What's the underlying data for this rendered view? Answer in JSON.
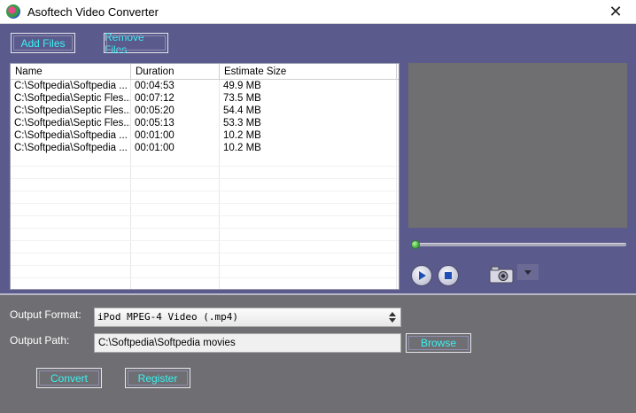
{
  "window": {
    "title": "Asoftech Video Converter",
    "close_glyph": "✕"
  },
  "toolbar": {
    "add_files_label": "Add Files",
    "remove_files_label": "Remove Files"
  },
  "file_list": {
    "columns": [
      "Name",
      "Duration",
      "Estimate Size"
    ],
    "rows": [
      {
        "name": "C:\\Softpedia\\Softpedia ...",
        "duration": "00:04:53",
        "size": "49.9 MB"
      },
      {
        "name": "C:\\Softpedia\\Septic Fles...",
        "duration": "00:07:12",
        "size": "73.5 MB"
      },
      {
        "name": "C:\\Softpedia\\Septic Fles...",
        "duration": "00:05:20",
        "size": "54.4 MB"
      },
      {
        "name": "C:\\Softpedia\\Septic Fles...",
        "duration": "00:05:13",
        "size": "53.3 MB"
      },
      {
        "name": "C:\\Softpedia\\Softpedia ...",
        "duration": "00:01:00",
        "size": "10.2 MB"
      },
      {
        "name": "C:\\Softpedia\\Softpedia ...",
        "duration": "00:01:00",
        "size": "10.2 MB"
      }
    ]
  },
  "player": {
    "progress": 0,
    "icons": [
      "play-icon",
      "stop-icon",
      "camera-icon",
      "dropdown-arrow-icon"
    ]
  },
  "output": {
    "format_label": "Output Format:",
    "format_value": "iPod MPEG-4 Video (.mp4)",
    "path_label": "Output Path:",
    "path_value": "C:\\Softpedia\\Softpedia movies",
    "browse_label": "Browse"
  },
  "actions": {
    "convert_label": "Convert",
    "register_label": "Register"
  },
  "colors": {
    "top_panel": "#5b5a8c",
    "bottom_panel": "#6f6f73",
    "button_text": "#3af0f0",
    "preview": "#6f6f71"
  }
}
